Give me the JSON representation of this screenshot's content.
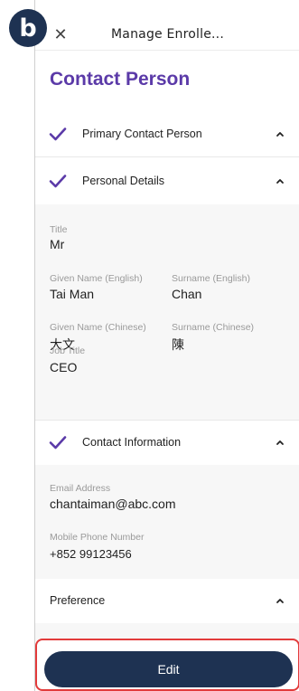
{
  "badge": "b",
  "header": {
    "title": "Manage Enrolle...",
    "close_icon": "close-icon"
  },
  "page_title": "Contact Person",
  "accent_color": "#5b3aa8",
  "sections": {
    "primary": {
      "label": "Primary Contact Person"
    },
    "personal": {
      "label": "Personal Details"
    },
    "contact": {
      "label": "Contact Information"
    },
    "preference": {
      "label": "Preference"
    }
  },
  "personal": {
    "title_label": "Title",
    "title_value": "Mr",
    "given_en_label": "Given Name (English)",
    "given_en_value": "Tai Man",
    "surname_en_label": "Surname (English)",
    "surname_en_value": "Chan",
    "given_zh_label": "Given Name (Chinese)",
    "given_zh_value": "大文",
    "surname_zh_label": "Surname (Chinese)",
    "surname_zh_value": "陳",
    "job_label": "Job Title",
    "job_value": "CEO"
  },
  "contact": {
    "email_label": "Email Address",
    "email_value": "chantaiman@abc.com",
    "mobile_label": "Mobile Phone Number",
    "mobile_value": "+852 99123456"
  },
  "edit_label": "Edit"
}
